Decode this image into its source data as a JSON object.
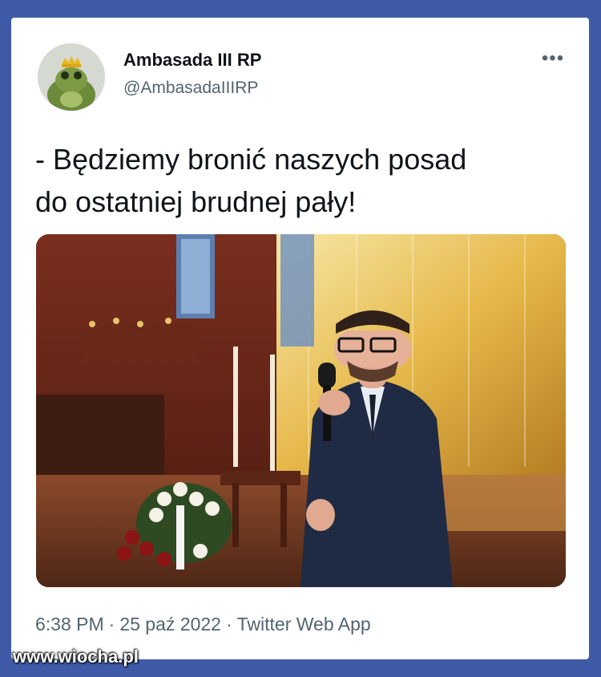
{
  "author": {
    "display_name": "Ambasada III RP",
    "handle": "@AmbasadaIIIRP",
    "avatar_icon": "frog-with-crown-icon"
  },
  "menu": {
    "more_label": "•••"
  },
  "tweet": {
    "text_line1": "- Będziemy bronić naszych posad",
    "text_line2": "do ostatniej brudnej pały!"
  },
  "meta": {
    "time": "6:38 PM",
    "separator": "·",
    "date": "25 paź 2022",
    "source": "Twitter Web App"
  },
  "watermark": "www.wiocha.pl",
  "colors": {
    "frame": "#3f5ba8",
    "text_primary": "#0f1419",
    "text_secondary": "#536471"
  }
}
